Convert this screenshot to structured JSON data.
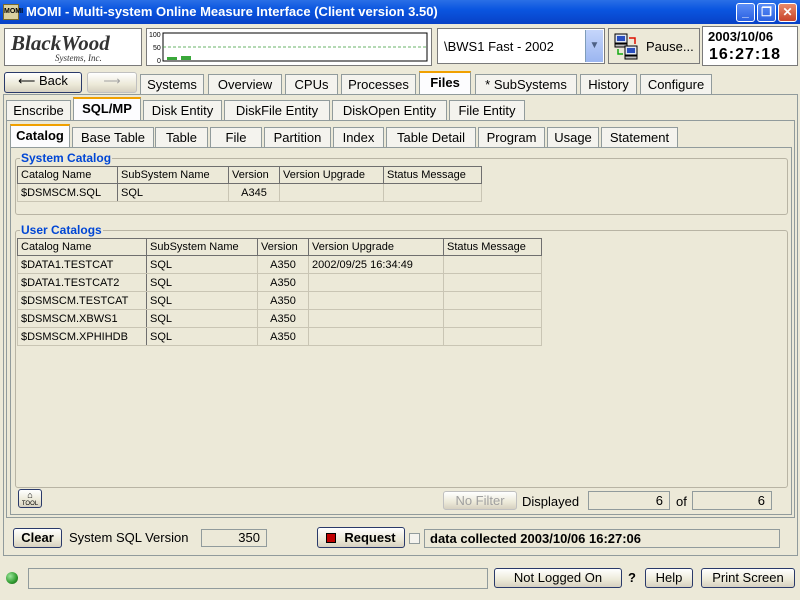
{
  "window": {
    "title": "MOMI - Multi-system Online Measure Interface (Client version 3.50)",
    "icon_text": "MOMI",
    "minimize": "_",
    "maximize": "❐",
    "close": "✕"
  },
  "logo": {
    "line1": "BlackWood",
    "line2": "Systems, Inc."
  },
  "graph": {
    "axis_labels": [
      "100",
      "50",
      "0"
    ]
  },
  "system_select": {
    "value": "\\BWS1 Fast - 2002"
  },
  "pause_button": {
    "label": "Pause..."
  },
  "datetime": {
    "date": "2003/10/06",
    "time": "16:27:18"
  },
  "nav": {
    "back": "Back",
    "forward": "",
    "tabs": [
      "Systems",
      "Overview",
      "CPUs",
      "Processes",
      "Files",
      "* SubSystems",
      "History",
      "Configure"
    ],
    "active": "Files"
  },
  "subtabs": {
    "tabs": [
      "Enscribe",
      "SQL/MP",
      "Disk Entity",
      "DiskFile Entity",
      "DiskOpen Entity",
      "File Entity"
    ],
    "active": "SQL/MP"
  },
  "subsubtabs": {
    "tabs": [
      "Catalog",
      "Base Table",
      "Table",
      "File",
      "Partition",
      "Index",
      "Table Detail",
      "Program",
      "Usage",
      "Statement"
    ],
    "active": "Catalog"
  },
  "system_catalog": {
    "title": "System Catalog",
    "columns": [
      "Catalog Name",
      "SubSystem Name",
      "Version",
      "Version Upgrade",
      "Status Message"
    ],
    "rows": [
      [
        "$DSMSCM.SQL",
        "SQL",
        "A345",
        "",
        ""
      ]
    ]
  },
  "user_catalogs": {
    "title": "User Catalogs",
    "columns": [
      "Catalog Name",
      "SubSystem Name",
      "Version",
      "Version Upgrade",
      "Status Message"
    ],
    "rows": [
      [
        "$DATA1.TESTCAT",
        "SQL",
        "A350",
        "2002/09/25 16:34:49",
        ""
      ],
      [
        "$DATA1.TESTCAT2",
        "SQL",
        "A350",
        "",
        ""
      ],
      [
        "$DSMSCM.TESTCAT",
        "SQL",
        "A350",
        "",
        ""
      ],
      [
        "$DSMSCM.XBWS1",
        "SQL",
        "A350",
        "",
        ""
      ],
      [
        "$DSMSCM.XPHIHDB",
        "SQL",
        "A350",
        "",
        ""
      ]
    ]
  },
  "footer_row": {
    "tool_label": "TOOL",
    "no_filter": "No Filter",
    "displayed_label": "Displayed",
    "displayed_value": "6",
    "of_label": "of",
    "total_value": "6"
  },
  "bottom": {
    "clear": "Clear",
    "sql_version_label": "System SQL Version",
    "sql_version_value": "350",
    "request": "Request",
    "collected": "data collected 2003/10/06 16:27:06"
  },
  "statusbar": {
    "status_text": "",
    "not_logged_on": "Not Logged On",
    "question": "?",
    "help": "Help",
    "print_screen": "Print Screen"
  },
  "colors": {
    "titlebar": "#0a55e0",
    "group_title": "#0046d5",
    "tab_highlight": "#f0a000",
    "status_led": "#2f9a2f",
    "request_icon": "#c00000"
  }
}
